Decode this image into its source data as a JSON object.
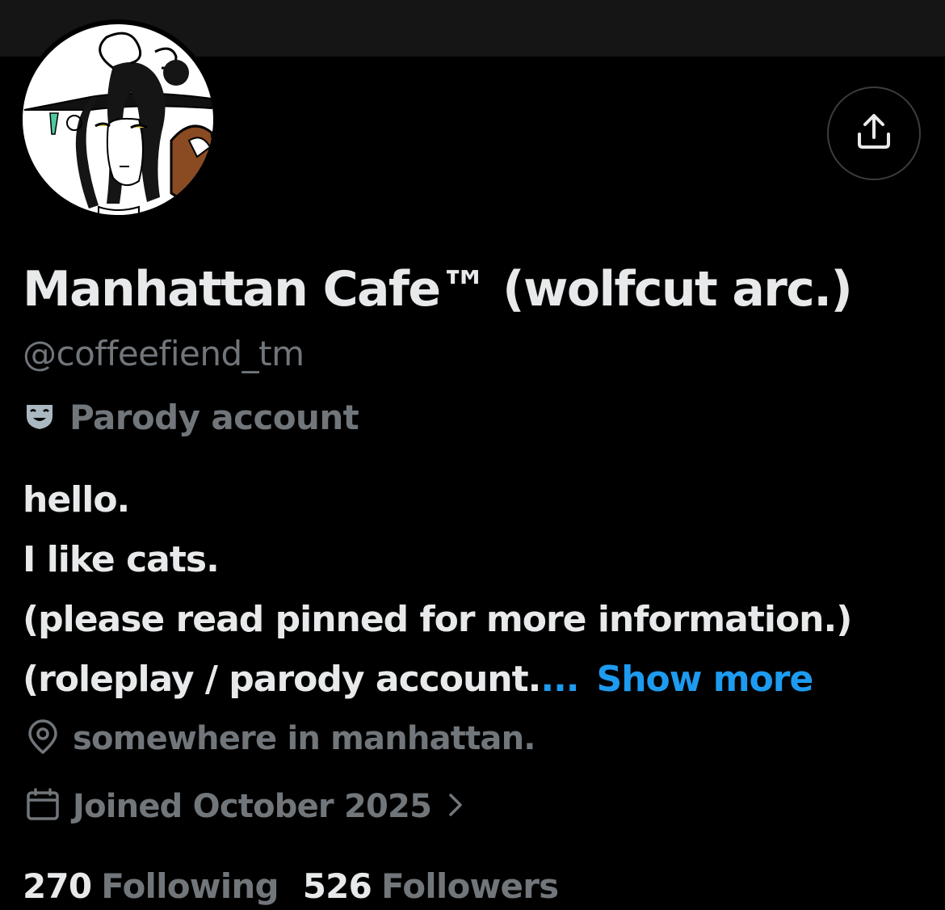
{
  "profile": {
    "display_name": "Manhattan Cafe™ (wolfcut arc.)",
    "handle": "@coffeefiend_tm",
    "label": "Parody account",
    "bio": {
      "line1": "hello.",
      "line2": "I like cats.",
      "line3": "(please read pinned for more information.)",
      "line4": "(roleplay / parody account.",
      "ellipsis": "...",
      "show_more": "Show more"
    },
    "location": "somewhere in manhattan.",
    "joined": "Joined October 2025",
    "following_count": "270",
    "following_label": "Following",
    "followers_count": "526",
    "followers_label": "Followers"
  },
  "icons": {
    "share": "share-icon",
    "parody": "parody-mask-icon",
    "location": "location-pin-icon",
    "calendar": "calendar-icon",
    "chevron": "chevron-right-icon"
  },
  "colors": {
    "background": "#000000",
    "banner": "#151515",
    "text_primary": "#e7e9ea",
    "text_secondary": "#71767b",
    "accent": "#1d9bf0",
    "border": "#3a3d40",
    "parody_badge": "#aab8c2"
  }
}
